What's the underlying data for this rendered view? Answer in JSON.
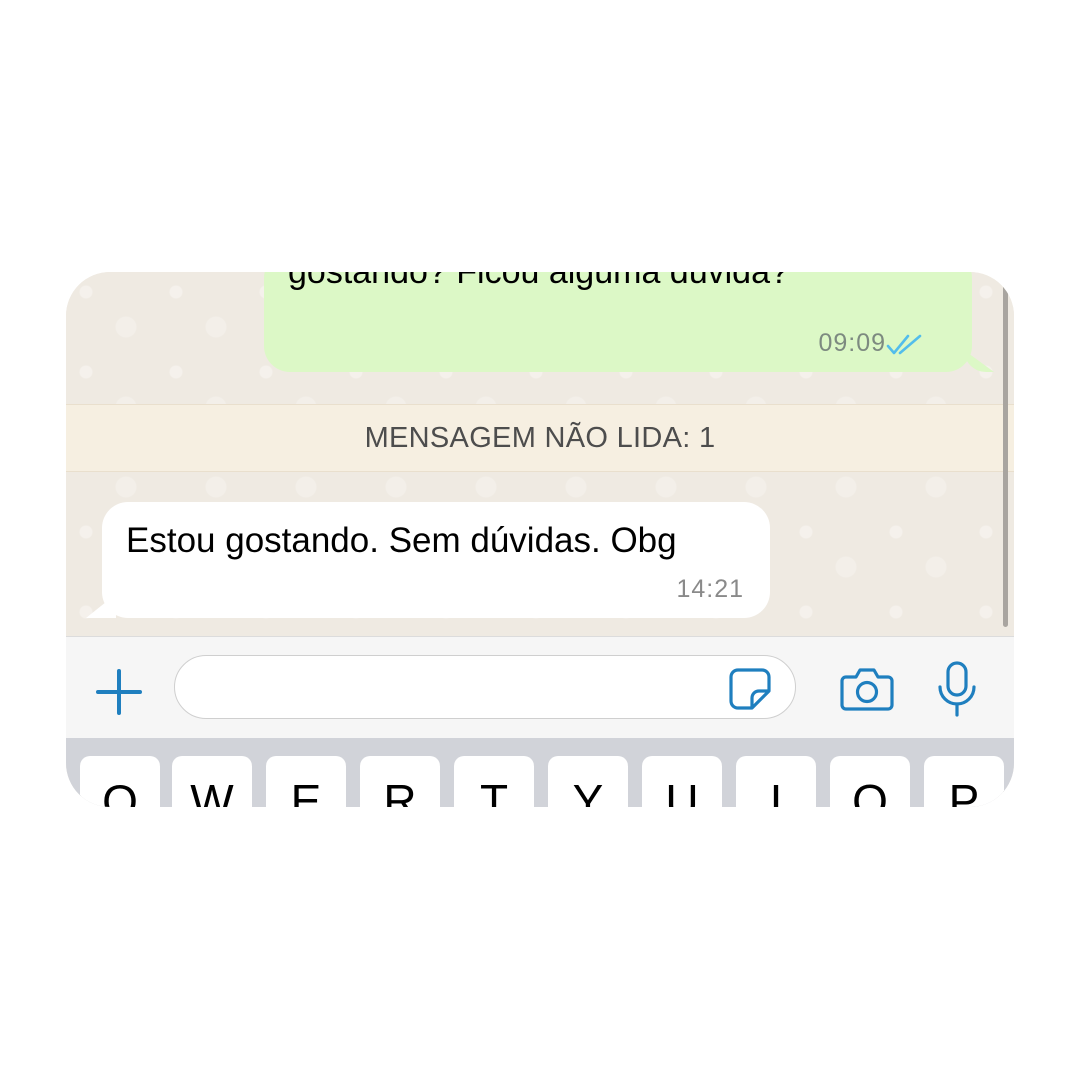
{
  "chat": {
    "outgoing": {
      "text": "gostando? Ficou alguma dúvida?",
      "time": "09:09",
      "status_icon": "double-check-read-icon"
    },
    "unread_banner": "MENSAGEM NÃO LIDA: 1",
    "incoming": {
      "text": "Estou gostando. Sem dúvidas. Obg",
      "time": "14:21"
    }
  },
  "input_bar": {
    "message_value": "",
    "icons": [
      "plus-icon",
      "sticker-icon",
      "camera-icon",
      "microphone-icon"
    ],
    "accent_color": "#1f7fbf"
  },
  "keyboard": {
    "keys": [
      "Q",
      "W",
      "E",
      "R",
      "T",
      "Y",
      "U",
      "I",
      "O",
      "P"
    ]
  },
  "colors": {
    "outgoing_bubble": "#dcf8c6",
    "incoming_bubble": "#ffffff",
    "chat_background": "#efeae2",
    "read_ticks": "#53bdeb"
  }
}
